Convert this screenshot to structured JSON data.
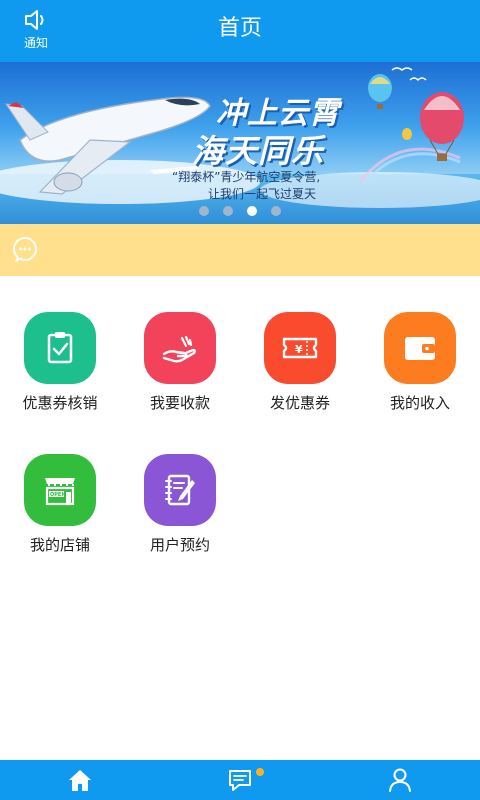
{
  "header": {
    "title": "首页",
    "notify_label": "通知",
    "notify_icon": "speaker-icon"
  },
  "banner": {
    "headline_line1": "冲上云霄",
    "headline_line2": "海天同乐",
    "subtitle_line1": "“翔泰杯”青少年航空夏令营,",
    "subtitle_line2": "让我们一起飞过夏天",
    "slides_count": 4,
    "active_slide": 3
  },
  "notice": {
    "icon": "chat-bubble-icon",
    "color": "#ffe08c"
  },
  "menu": [
    {
      "label": "优惠券核销",
      "icon": "clipboard-check-icon",
      "color": "#1dbf8d"
    },
    {
      "label": "我要收款",
      "icon": "hand-payment-icon",
      "color": "#f2435a"
    },
    {
      "label": "发优惠券",
      "icon": "coupon-ticket-icon",
      "color": "#fb4b2e"
    },
    {
      "label": "我的收入",
      "icon": "wallet-icon",
      "color": "#fd7c1f"
    },
    {
      "label": "我的店铺",
      "icon": "open-store-icon",
      "color": "#33bd3d"
    },
    {
      "label": "用户预约",
      "icon": "notebook-pen-icon",
      "color": "#8b56d6"
    }
  ],
  "bottom_nav": [
    {
      "name": "home",
      "icon": "home-icon",
      "active": true
    },
    {
      "name": "messages",
      "icon": "message-icon",
      "has_badge": true
    },
    {
      "name": "profile",
      "icon": "user-icon"
    }
  ],
  "colors": {
    "primary": "#0f9af0",
    "badge": "#ffb21f"
  }
}
